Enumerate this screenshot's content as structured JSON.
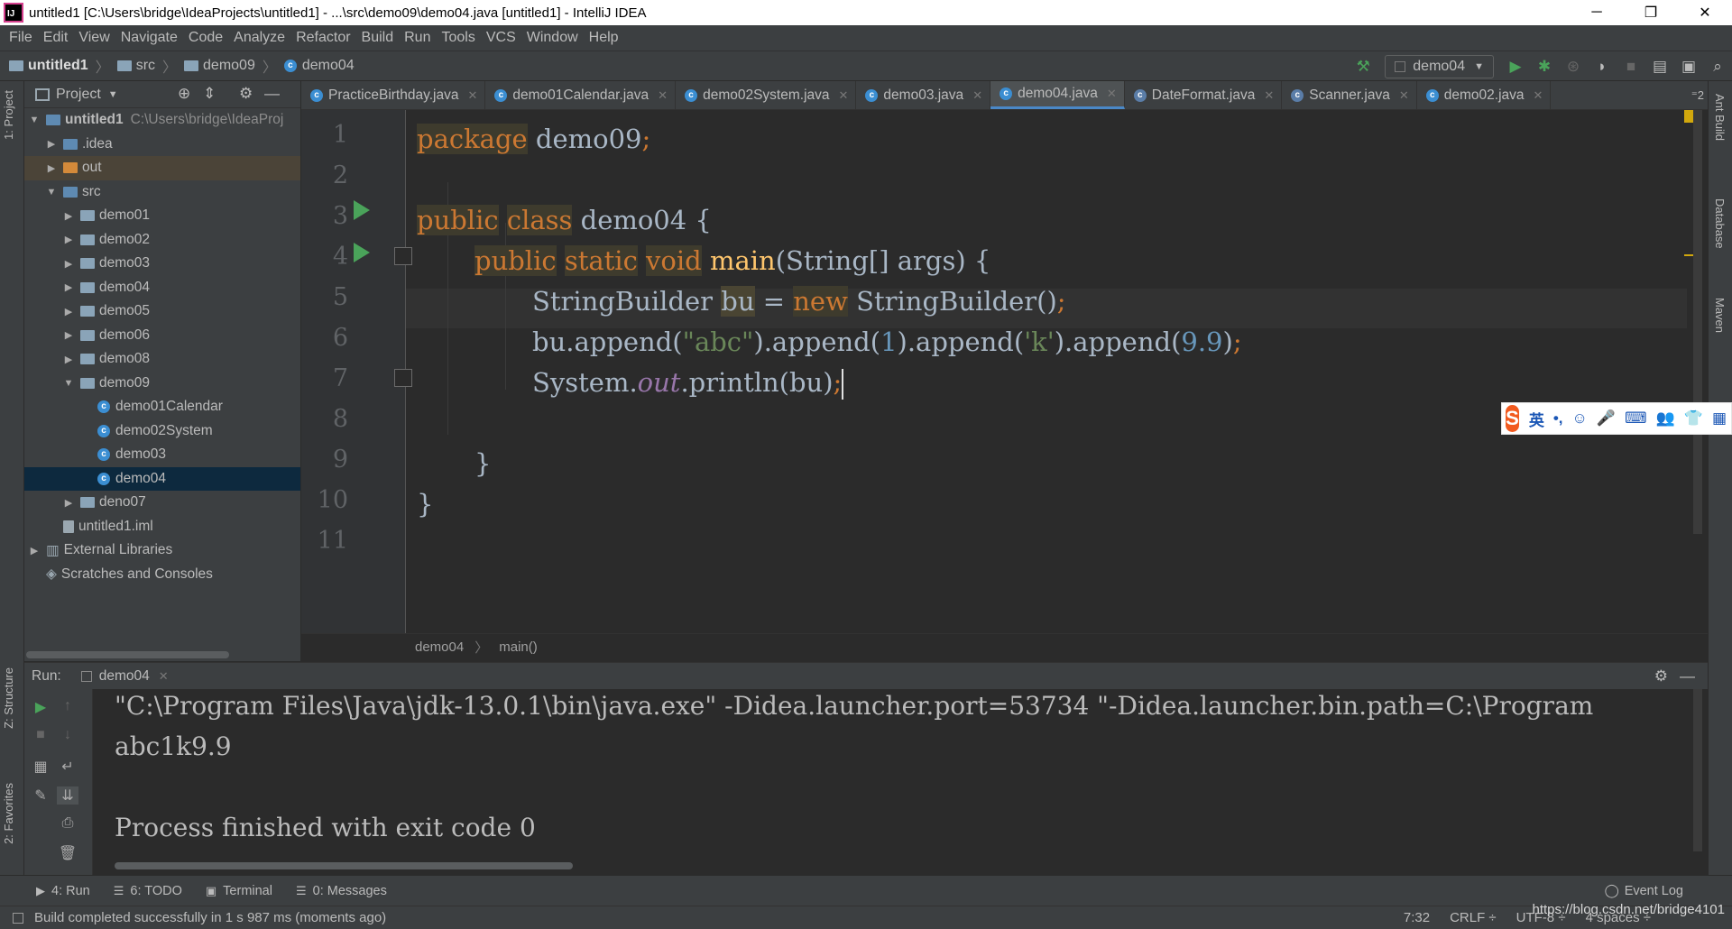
{
  "window": {
    "title": "untitled1 [C:\\Users\\bridge\\IdeaProjects\\untitled1] - ...\\src\\demo09\\demo04.java [untitled1] - IntelliJ IDEA",
    "minimize": "─",
    "restore": "❐",
    "close": "✕"
  },
  "menu": [
    "File",
    "Edit",
    "View",
    "Navigate",
    "Code",
    "Analyze",
    "Refactor",
    "Build",
    "Run",
    "Tools",
    "VCS",
    "Window",
    "Help"
  ],
  "nav": {
    "project": "untitled1",
    "src": "src",
    "package": "demo09",
    "file": "demo04",
    "run_config": "demo04"
  },
  "project_panel": {
    "title": "Project",
    "tree": [
      {
        "label": "untitled1",
        "dim": "C:\\Users\\bridge\\IdeaProj",
        "indent": 0,
        "arrow": "▼",
        "icon": "folder"
      },
      {
        "label": ".idea",
        "indent": 1,
        "arrow": "▶",
        "icon": "folder"
      },
      {
        "label": "out",
        "indent": 1,
        "arrow": "▶",
        "icon": "folder-orange"
      },
      {
        "label": "src",
        "indent": 1,
        "arrow": "▼",
        "icon": "folder"
      },
      {
        "label": "demo01",
        "indent": 2,
        "arrow": "▶",
        "icon": "package"
      },
      {
        "label": "demo02",
        "indent": 2,
        "arrow": "▶",
        "icon": "package"
      },
      {
        "label": "demo03",
        "indent": 2,
        "arrow": "▶",
        "icon": "package"
      },
      {
        "label": "demo04",
        "indent": 2,
        "arrow": "▶",
        "icon": "package"
      },
      {
        "label": "demo05",
        "indent": 2,
        "arrow": "▶",
        "icon": "package"
      },
      {
        "label": "demo06",
        "indent": 2,
        "arrow": "▶",
        "icon": "package"
      },
      {
        "label": "demo08",
        "indent": 2,
        "arrow": "▶",
        "icon": "package"
      },
      {
        "label": "demo09",
        "indent": 2,
        "arrow": "▼",
        "icon": "package"
      },
      {
        "label": "demo01Calendar",
        "indent": 3,
        "arrow": "",
        "icon": "class"
      },
      {
        "label": "demo02System",
        "indent": 3,
        "arrow": "",
        "icon": "class"
      },
      {
        "label": "demo03",
        "indent": 3,
        "arrow": "",
        "icon": "class"
      },
      {
        "label": "demo04",
        "indent": 3,
        "arrow": "",
        "icon": "class",
        "selected": true
      },
      {
        "label": "deno07",
        "indent": 2,
        "arrow": "▶",
        "icon": "package"
      },
      {
        "label": "untitled1.iml",
        "indent": 1,
        "arrow": "",
        "icon": "file"
      },
      {
        "label": "External Libraries",
        "indent": 0,
        "arrow": "▶",
        "icon": "library"
      },
      {
        "label": "Scratches and Consoles",
        "indent": 0,
        "arrow": "",
        "icon": "scratch"
      }
    ]
  },
  "tabs": [
    {
      "label": "PracticeBirthday.java",
      "active": false
    },
    {
      "label": "demo01Calendar.java",
      "active": false
    },
    {
      "label": "demo02System.java",
      "active": false
    },
    {
      "label": "demo03.java",
      "active": false
    },
    {
      "label": "demo04.java",
      "active": true
    },
    {
      "label": "DateFormat.java",
      "active": false
    },
    {
      "label": "Scanner.java",
      "active": false
    },
    {
      "label": "demo02.java",
      "active": false
    }
  ],
  "tabs_more": "⁼2",
  "editor": {
    "line_numbers": [
      "1",
      "2",
      "3",
      "4",
      "5",
      "6",
      "7",
      "8",
      "9",
      "10",
      "11"
    ],
    "code": {
      "l1_kw": "package",
      "l1_rest": " demo09",
      "l1_semi": ";",
      "l3_kw1": "public",
      "l3_kw2": "class",
      "l3_rest": " demo04 {",
      "l4_kw1": "public",
      "l4_kw2": "static",
      "l4_kw3": "void",
      "l4_fn": "main",
      "l4_rest": "(String[] args) {",
      "l5_a": "StringBuilder ",
      "l5_var": "bu",
      "l5_eq": " = ",
      "l5_kw": "new",
      "l5_rest": " StringBuilder()",
      "l5_semi": ";",
      "l6_a": "bu.append(",
      "l6_s1": "\"abc\"",
      "l6_b": ").append(",
      "l6_n1": "1",
      "l6_c": ").append(",
      "l6_s2": "'k'",
      "l6_d": ").append(",
      "l6_n2": "9.9",
      "l6_e": ")",
      "l6_semi": ";",
      "l7_a": "System.",
      "l7_st": "out",
      "l7_b": ".println(bu)",
      "l7_semi": ";",
      "l9": "}",
      "l10": "}"
    }
  },
  "breadcrumb": [
    "demo04",
    "main()"
  ],
  "ime": {
    "logo": "S",
    "items": [
      "英",
      "•,",
      "☺",
      "🎤",
      "⌨",
      "👥",
      "👕",
      "▦"
    ]
  },
  "run": {
    "label": "Run:",
    "tab": "demo04",
    "console": [
      "\"C:\\Program Files\\Java\\jdk-13.0.1\\bin\\java.exe\" -Didea.launcher.port=53734 \"-Didea.launcher.bin.path=C:\\Program",
      "abc1k9.9",
      "",
      "Process finished with exit code 0"
    ]
  },
  "left_tabs": {
    "project": "1: Project",
    "structure": "Z: Structure",
    "favorites": "2: Favorites"
  },
  "right_tabs": {
    "ant": "Ant Build",
    "database": "Database",
    "maven": "Maven"
  },
  "bottom_tools": [
    {
      "label": "4: Run",
      "glyph": "▶"
    },
    {
      "label": "6: TODO",
      "glyph": "☰"
    },
    {
      "label": "Terminal",
      "glyph": "▣"
    },
    {
      "label": "0: Messages",
      "glyph": "☰"
    }
  ],
  "event_log": "Event Log",
  "status": {
    "message": "Build completed successfully in 1 s 987 ms (moments ago)",
    "position": "7:32",
    "line_sep": "CRLF ÷",
    "encoding": "UTF-8 ÷",
    "indent": "4 spaces ÷",
    "watermark": "https://blog.csdn.net/bridge4101"
  }
}
